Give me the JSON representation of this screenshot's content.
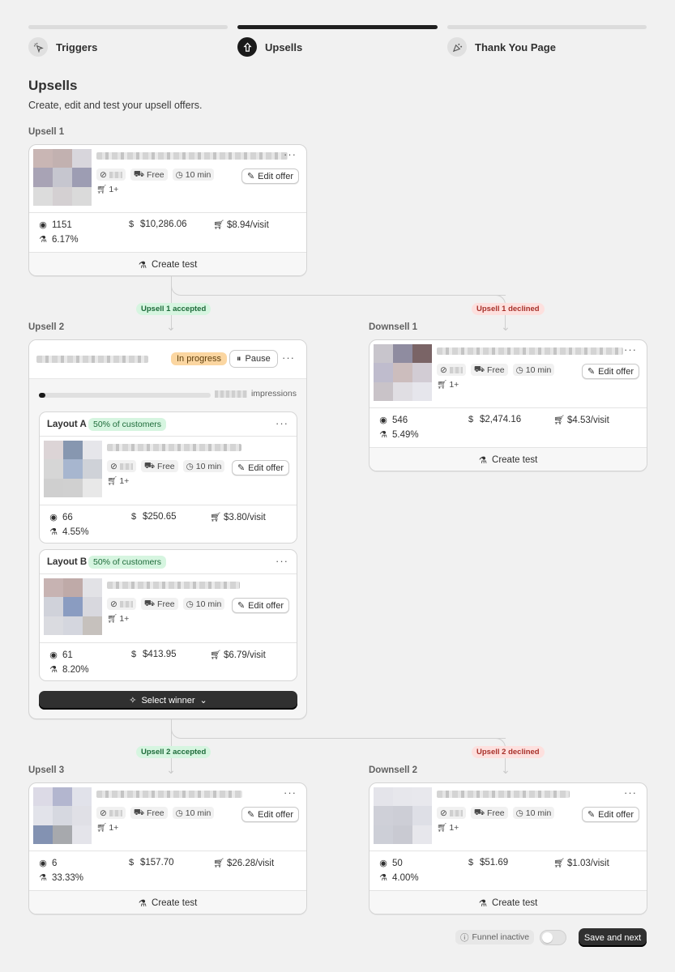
{
  "steps": [
    {
      "label": "Triggers",
      "icon": "sparkle-pointer-icon",
      "active": false
    },
    {
      "label": "Upsells",
      "icon": "upsell-icon",
      "active": true
    },
    {
      "label": "Thank You Page",
      "icon": "confetti-icon",
      "active": false
    }
  ],
  "page": {
    "title": "Upsells",
    "subtitle": "Create, edit and test your upsell offers."
  },
  "common": {
    "free": "Free",
    "time": "10 min",
    "qty": "1+",
    "edit_offer": "Edit offer",
    "create_test": "Create test",
    "more": "···"
  },
  "upsell1": {
    "label": "Upsell 1",
    "views": "1151",
    "revenue": "$10,286.06",
    "per_visit": "$8.94/visit",
    "conversion": "6.17%"
  },
  "branch1": {
    "accepted": "Upsell 1 accepted",
    "declined": "Upsell 1 declined"
  },
  "upsell2": {
    "label": "Upsell 2",
    "status": "In progress",
    "pause": "Pause",
    "impressions": "impressions",
    "progress": 0.04,
    "layout_a": {
      "name": "Layout A",
      "share": "50% of customers",
      "views": "66",
      "revenue": "$250.65",
      "per_visit": "$3.80/visit",
      "conversion": "4.55%"
    },
    "layout_b": {
      "name": "Layout B",
      "share": "50% of customers",
      "views": "61",
      "revenue": "$413.95",
      "per_visit": "$6.79/visit",
      "conversion": "8.20%"
    },
    "select_winner": "Select winner"
  },
  "downsell1": {
    "label": "Downsell 1",
    "views": "546",
    "revenue": "$2,474.16",
    "per_visit": "$4.53/visit",
    "conversion": "5.49%"
  },
  "branch2": {
    "accepted": "Upsell 2 accepted",
    "declined": "Upsell 2 declined"
  },
  "upsell3": {
    "label": "Upsell 3",
    "views": "6",
    "revenue": "$157.70",
    "per_visit": "$26.28/visit",
    "conversion": "33.33%"
  },
  "downsell2": {
    "label": "Downsell 2",
    "views": "50",
    "revenue": "$51.69",
    "per_visit": "$1.03/visit",
    "conversion": "4.00%"
  },
  "footer": {
    "funnel_status": "Funnel inactive",
    "save": "Save and next"
  },
  "colors": {
    "accent": "#303030",
    "green_badge": "#d6f5e0",
    "red_badge": "#fde0de",
    "in_progress": "#fbd6a1"
  }
}
